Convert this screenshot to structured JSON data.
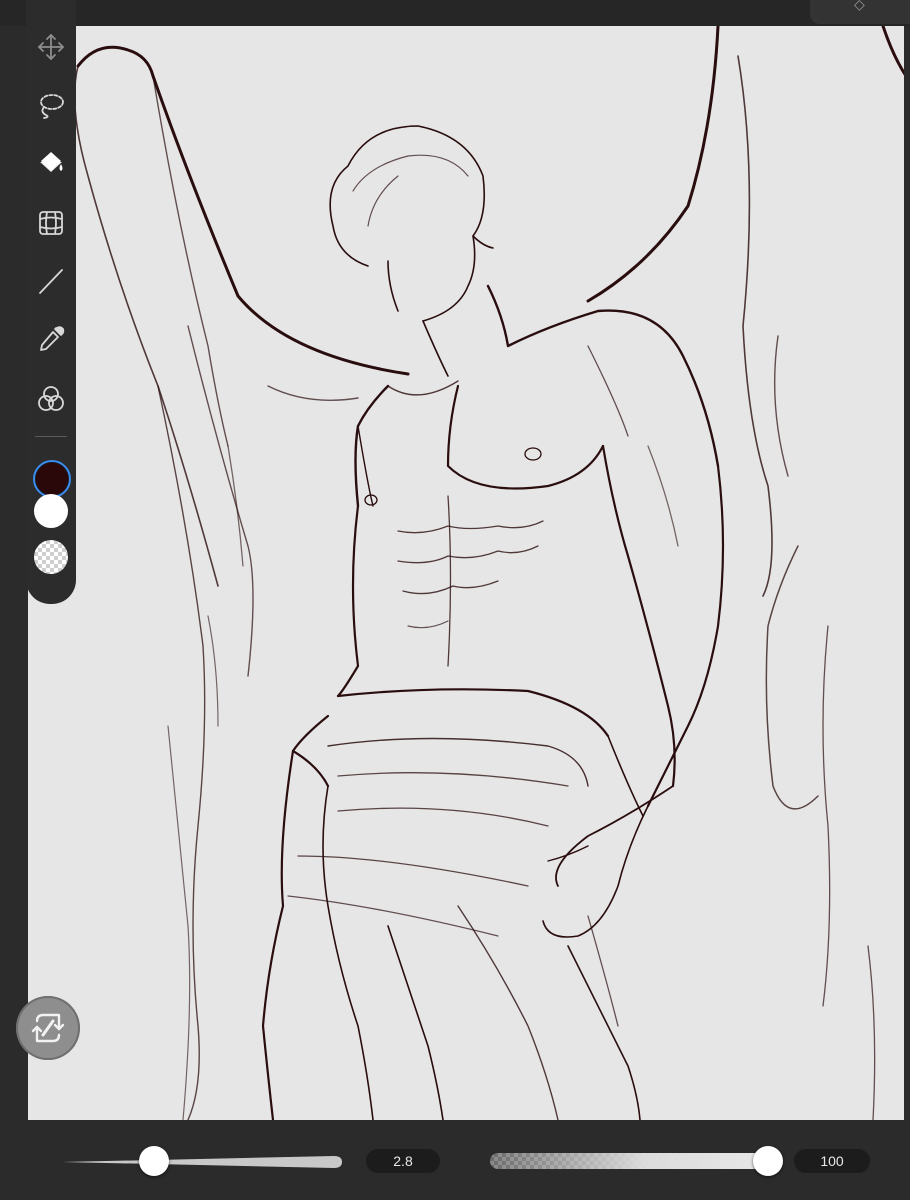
{
  "app": {
    "toolbar": {
      "tools": [
        {
          "name": "move",
          "icon": "move-icon"
        },
        {
          "name": "lasso",
          "icon": "lasso-icon"
        },
        {
          "name": "fill",
          "icon": "fill-bucket-icon"
        },
        {
          "name": "transform-grid",
          "icon": "grid-transform-icon"
        },
        {
          "name": "line",
          "icon": "line-icon"
        },
        {
          "name": "eyedropper",
          "icon": "eyedropper-icon"
        },
        {
          "name": "color-mix",
          "icon": "color-circles-icon"
        }
      ],
      "colors": {
        "primary": "#2a0709",
        "secondary": "#ffffff",
        "active_ring": "#3a8cf0"
      }
    },
    "floating_button": {
      "icon": "flip-transform-icon"
    },
    "bottom_bar": {
      "brush_size": {
        "value_label": "2.8",
        "level": 0.33
      },
      "opacity": {
        "value_label": "100",
        "level": 1.0
      }
    },
    "canvas": {
      "background": "#e6e6e6",
      "ink": "#2a0d0e"
    }
  }
}
